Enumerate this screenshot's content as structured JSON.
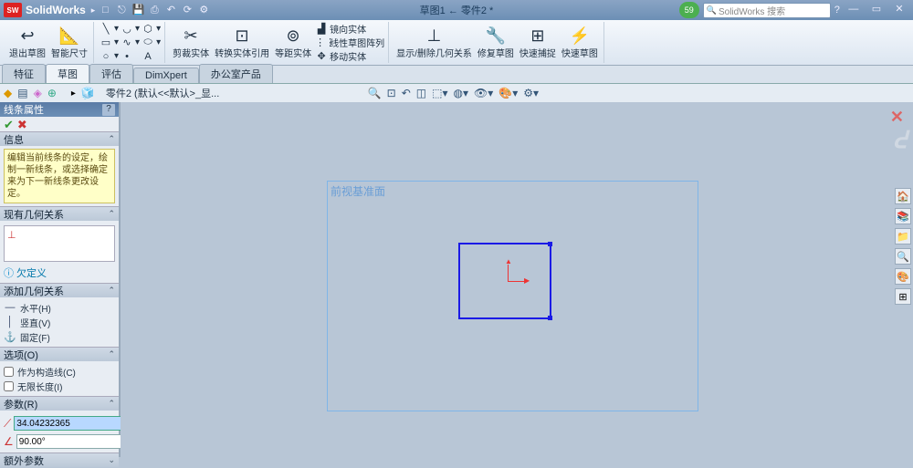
{
  "app": {
    "name": "SolidWorks",
    "doc_title": "草图1 ← 零件2 *"
  },
  "search": {
    "placeholder": "SolidWorks 搜索",
    "badge": "59"
  },
  "ribbon": {
    "exit_sketch": "退出草图",
    "smart_dim": "智能尺寸",
    "boss": "剪裁实体",
    "convert": "转换实体引用",
    "offset": "等距实体",
    "mirror": "镜向实体",
    "pattern": "线性草图阵列",
    "move": "移动实体",
    "show_del": "显示/删除几何关系",
    "repair": "修复草图",
    "quick_snap": "快速捕捉",
    "rapid": "快速草图"
  },
  "tabs": {
    "t1": "特征",
    "t2": "草图",
    "t3": "评估",
    "t4": "DimXpert",
    "t5": "办公室产品"
  },
  "tree": {
    "root": "零件2 (默认<<默认>_显..."
  },
  "pm": {
    "title": "线条属性",
    "info_head": "信息",
    "info_text": "编辑当前线条的设定，绘制一新线条，或选择确定来为下一新线条更改设定。",
    "exist_rel": "现有几何关系",
    "undef": "欠定义",
    "add_rel": "添加几何关系",
    "rel_h": "水平(H)",
    "rel_v": "竖直(V)",
    "rel_f": "固定(F)",
    "options": "选项(O)",
    "opt_c": "作为构造线(C)",
    "opt_i": "无限长度(I)",
    "params": "参数(R)",
    "p_len": "34.04232365",
    "p_ang": "90.00°",
    "extra": "额外参数"
  },
  "viewport": {
    "plane_label": "前视基准面"
  }
}
